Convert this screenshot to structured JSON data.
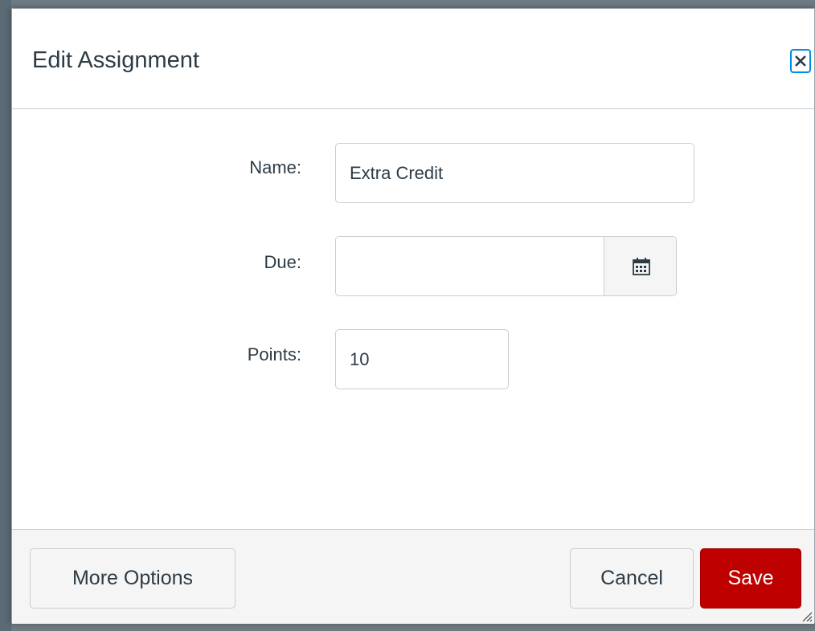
{
  "dialog": {
    "title": "Edit Assignment",
    "close_icon": "close-icon"
  },
  "form": {
    "name": {
      "label": "Name:",
      "value": "Extra Credit"
    },
    "due": {
      "label": "Due:",
      "value": "",
      "calendar_icon": "calendar-icon"
    },
    "points": {
      "label": "Points:",
      "value": "10"
    }
  },
  "footer": {
    "more_options_label": "More Options",
    "cancel_label": "Cancel",
    "save_label": "Save"
  },
  "colors": {
    "save_bg": "#bf0000",
    "focus_ring": "#008ee2",
    "text": "#2d3b45"
  }
}
